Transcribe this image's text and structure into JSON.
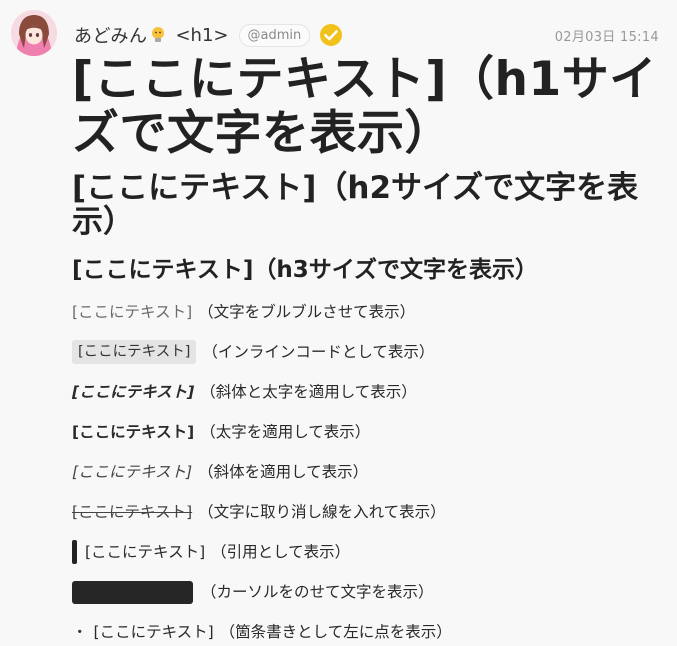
{
  "user": {
    "name": "あどみん",
    "tag": "<h1>",
    "handle": "@admin",
    "timestamp": "02月03日 15:14"
  },
  "post": {
    "h1": "[ここにテキスト]（h1サイズで文字を表示）",
    "h2": "[ここにテキスト]（h2サイズで文字を表示）",
    "h3": "[ここにテキスト]（h3サイズで文字を表示）",
    "rows": [
      {
        "style": "blur",
        "text": "[ここにテキスト]",
        "desc": "（文字をブルブルさせて表示）"
      },
      {
        "style": "code",
        "text": "[ここにテキスト]",
        "desc": "（インラインコードとして表示）"
      },
      {
        "style": "bold-italic",
        "text": "[ここにテキスト]",
        "desc": "（斜体と太字を適用して表示）"
      },
      {
        "style": "bold",
        "text": "[ここにテキスト]",
        "desc": "（太字を適用して表示）"
      },
      {
        "style": "italic",
        "text": "[ここにテキスト]",
        "desc": "（斜体を適用して表示）"
      },
      {
        "style": "strike",
        "text": "[ここにテキスト]",
        "desc": "（文字に取り消し線を入れて表示）"
      },
      {
        "style": "quote",
        "text": "[ここにテキスト]",
        "desc": "（引用として表示）"
      },
      {
        "style": "spoiler",
        "text": "",
        "desc": "（カーソルをのせて文字を表示）"
      },
      {
        "style": "bullet",
        "bullet": "・",
        "text": "[ここにテキスト]",
        "desc": "（箇条書きとして左に点を表示）"
      }
    ]
  },
  "icons": {
    "avatar": "avatar-image",
    "emoji": "lightbulb-character-icon",
    "verified": "verified-check-icon"
  },
  "colors": {
    "background": "#f8f8f8",
    "verified": "#f2c21c",
    "spoiler": "#262626"
  }
}
